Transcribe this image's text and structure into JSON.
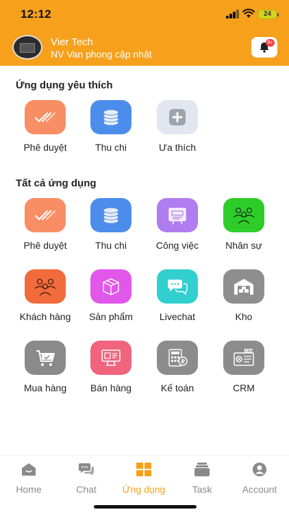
{
  "status_bar": {
    "time": "12:12",
    "battery": "24"
  },
  "header": {
    "user_name": "Vier Tech",
    "user_role": "NV Van phong cập nhật",
    "notification_badge": "9+",
    "accent_color": "#F7A01C"
  },
  "favorites": {
    "title": "Ứng dụng yêu thích",
    "apps": [
      {
        "label": "Phê duyệt",
        "icon": "double-check-icon",
        "color": "#F98E65"
      },
      {
        "label": "Thu chi",
        "icon": "coins-icon",
        "color": "#4C8DEB"
      },
      {
        "label": "Ưa thích",
        "icon": "plus-icon",
        "color": "#E3E6EE"
      }
    ]
  },
  "all_apps": {
    "title": "Tất cả ứng dụng",
    "apps": [
      {
        "label": "Phê duyệt",
        "icon": "double-check-icon",
        "color": "#F98E65"
      },
      {
        "label": "Thu chi",
        "icon": "coins-icon",
        "color": "#4C8DEB"
      },
      {
        "label": "Công việc",
        "icon": "todo-board-icon",
        "color": "#B07DF0"
      },
      {
        "label": "Nhân sự",
        "icon": "staff-group-icon",
        "color": "#2ECC29"
      },
      {
        "label": "Khách hàng",
        "icon": "customers-icon",
        "color": "#F26B3C"
      },
      {
        "label": "Sản phẩm",
        "icon": "box-icon",
        "color": "#E057E9"
      },
      {
        "label": "Livechat",
        "icon": "chat-bubbles-icon",
        "color": "#33CFCF"
      },
      {
        "label": "Kho",
        "icon": "warehouse-icon",
        "color": "#8E8E8E"
      },
      {
        "label": "Mua hàng",
        "icon": "cart-icon",
        "color": "#8A8A8A"
      },
      {
        "label": "Bán hàng",
        "icon": "pos-terminal-icon",
        "color": "#F0647E"
      },
      {
        "label": "Kế toán",
        "icon": "calculator-icon",
        "color": "#8C8C8C"
      },
      {
        "label": "CRM",
        "icon": "crm-screen-icon",
        "color": "#8C8C8C"
      }
    ]
  },
  "bottom_nav": {
    "items": [
      {
        "label": "Home",
        "icon": "home-icon"
      },
      {
        "label": "Chat",
        "icon": "chat-icon"
      },
      {
        "label": "Ứng dụng",
        "icon": "apps-grid-icon",
        "active": true
      },
      {
        "label": "Task",
        "icon": "task-icon"
      },
      {
        "label": "Account",
        "icon": "account-icon"
      }
    ]
  }
}
